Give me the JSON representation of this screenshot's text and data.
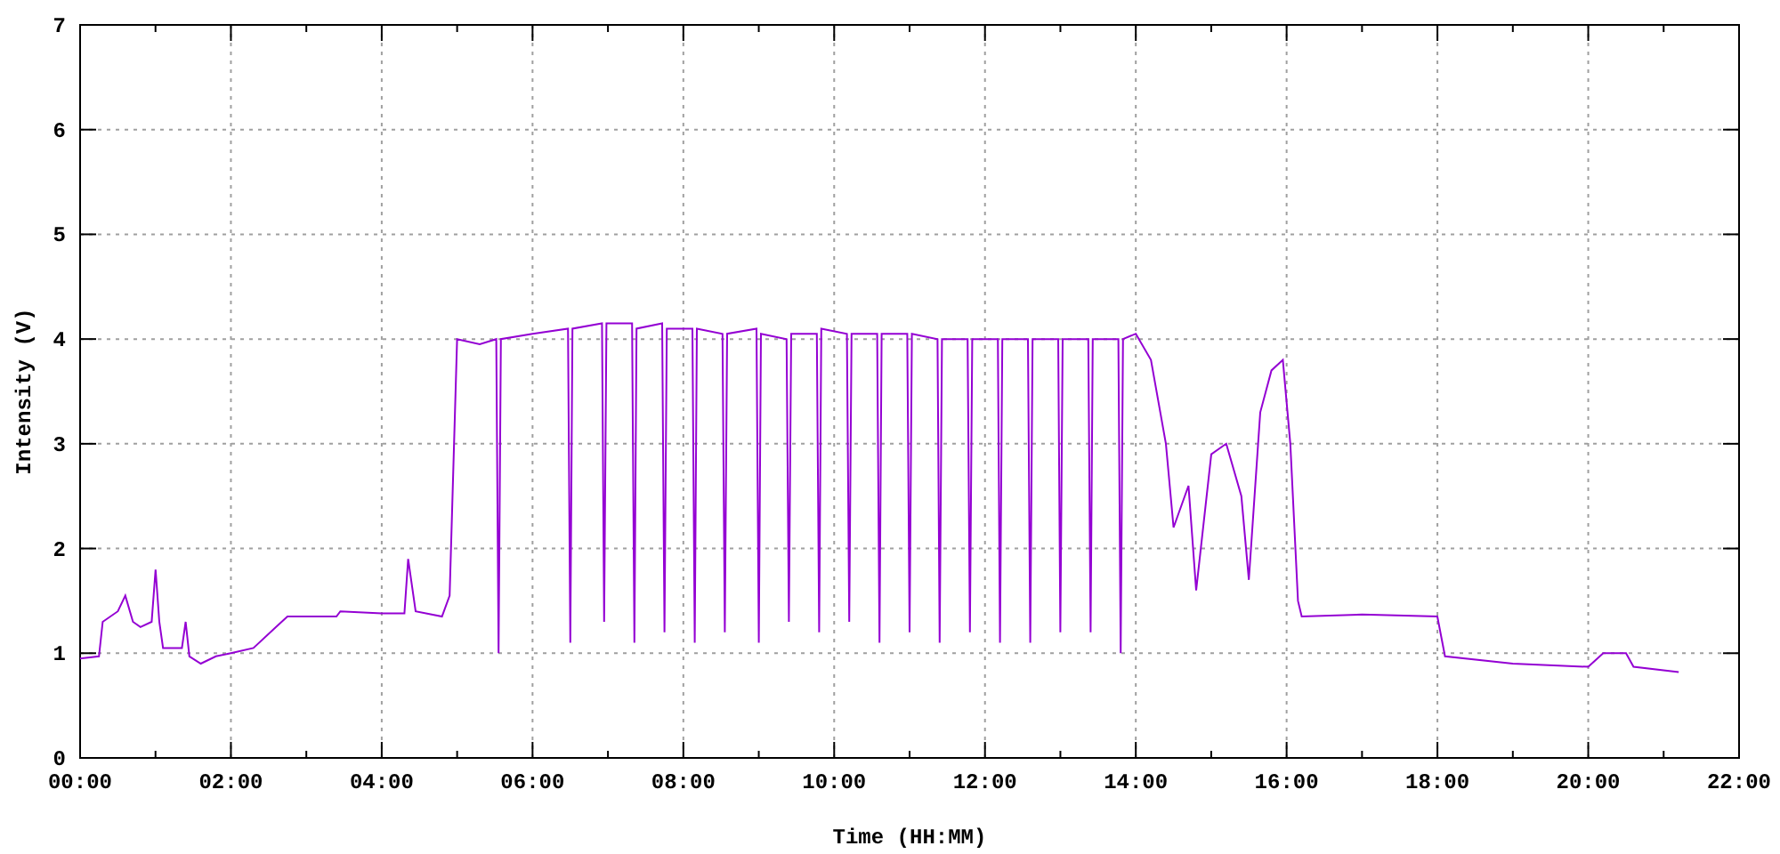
{
  "chart": {
    "chart_data": {
      "type": "line",
      "xlabel": "Time (HH:MM)",
      "ylabel": "Intensity (V)",
      "grid": true,
      "xlim": [
        0,
        22
      ],
      "ylim": [
        0,
        7
      ],
      "xticks": [
        {
          "value": 0,
          "label": "00:00"
        },
        {
          "value": 2,
          "label": "02:00"
        },
        {
          "value": 4,
          "label": "04:00"
        },
        {
          "value": 6,
          "label": "06:00"
        },
        {
          "value": 8,
          "label": "08:00"
        },
        {
          "value": 10,
          "label": "10:00"
        },
        {
          "value": 12,
          "label": "12:00"
        },
        {
          "value": 14,
          "label": "14:00"
        },
        {
          "value": 16,
          "label": "16:00"
        },
        {
          "value": 18,
          "label": "18:00"
        },
        {
          "value": 20,
          "label": "20:00"
        },
        {
          "value": 22,
          "label": "22:00"
        }
      ],
      "yticks": [
        0,
        1,
        2,
        3,
        4,
        5,
        6,
        7
      ],
      "x": [
        0,
        0.25,
        0.3,
        0.5,
        0.6,
        0.7,
        0.8,
        0.95,
        1.0,
        1.05,
        1.1,
        1.35,
        1.4,
        1.45,
        1.6,
        1.8,
        2.0,
        2.3,
        2.6,
        2.75,
        3.0,
        3.4,
        3.45,
        4.0,
        4.3,
        4.35,
        4.45,
        4.8,
        4.9,
        5.0,
        5.3,
        5.52,
        5.55,
        5.58,
        6.0,
        6.47,
        6.5,
        6.53,
        6.92,
        6.95,
        6.98,
        7.32,
        7.35,
        7.38,
        7.72,
        7.75,
        7.78,
        8.12,
        8.15,
        8.18,
        8.52,
        8.55,
        8.58,
        8.97,
        9.0,
        9.03,
        9.37,
        9.4,
        9.43,
        9.77,
        9.8,
        9.83,
        10.17,
        10.2,
        10.23,
        10.57,
        10.6,
        10.63,
        10.97,
        11.0,
        11.03,
        11.37,
        11.4,
        11.43,
        11.77,
        11.8,
        11.83,
        12.17,
        12.2,
        12.23,
        12.57,
        12.6,
        12.63,
        12.97,
        13.0,
        13.03,
        13.37,
        13.4,
        13.43,
        13.77,
        13.8,
        13.83,
        14.0,
        14.2,
        14.4,
        14.5,
        14.7,
        14.8,
        15.0,
        15.2,
        15.4,
        15.5,
        15.65,
        15.8,
        15.95,
        16.05,
        16.15,
        16.2,
        17.0,
        18.0,
        18.1,
        19.0,
        20.0,
        20.2,
        20.5,
        20.6,
        21.2
      ],
      "series": [
        {
          "color": "#9400d3",
          "values": [
            0.95,
            0.97,
            1.3,
            1.4,
            1.55,
            1.3,
            1.25,
            1.3,
            1.8,
            1.3,
            1.05,
            1.05,
            1.3,
            0.97,
            0.9,
            0.97,
            1.0,
            1.05,
            1.25,
            1.35,
            1.35,
            1.35,
            1.4,
            1.38,
            1.38,
            1.9,
            1.4,
            1.35,
            1.55,
            4.0,
            3.95,
            4.0,
            1.0,
            4.0,
            4.05,
            4.1,
            1.1,
            4.1,
            4.15,
            1.3,
            4.15,
            4.15,
            1.1,
            4.1,
            4.15,
            1.2,
            4.1,
            4.1,
            1.1,
            4.1,
            4.05,
            1.2,
            4.05,
            4.1,
            1.1,
            4.05,
            4.0,
            1.3,
            4.05,
            4.05,
            1.2,
            4.1,
            4.05,
            1.3,
            4.05,
            4.05,
            1.1,
            4.05,
            4.05,
            1.2,
            4.05,
            4.0,
            1.1,
            4.0,
            4.0,
            1.2,
            4.0,
            4.0,
            1.1,
            4.0,
            4.0,
            1.1,
            4.0,
            4.0,
            1.2,
            4.0,
            4.0,
            1.2,
            4.0,
            4.0,
            1.0,
            4.0,
            4.05,
            3.8,
            3.0,
            2.2,
            2.6,
            1.6,
            2.9,
            3.0,
            2.5,
            1.7,
            3.3,
            3.7,
            3.8,
            3.0,
            1.5,
            1.35,
            1.37,
            1.35,
            0.97,
            0.9,
            0.87,
            1.0,
            1.0,
            0.87,
            0.82
          ]
        }
      ]
    }
  }
}
